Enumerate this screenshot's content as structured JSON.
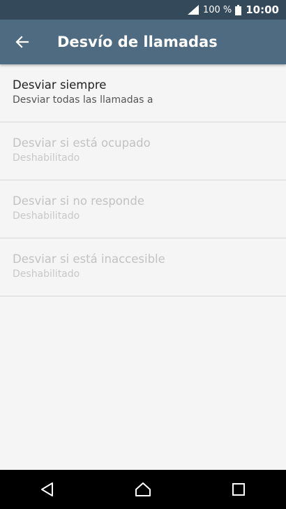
{
  "status_bar": {
    "battery_percent": "100 %",
    "time": "10:00",
    "icons": [
      "signal-icon",
      "battery-icon"
    ]
  },
  "app_bar": {
    "title": "Desvío de llamadas",
    "back_icon": "back-arrow-icon"
  },
  "settings": [
    {
      "title": "Desviar siempre",
      "summary": "Desviar todas las llamadas a",
      "enabled": true
    },
    {
      "title": "Desviar si está ocupado",
      "summary": "Deshabilitado",
      "enabled": false
    },
    {
      "title": "Desviar si no responde",
      "summary": "Deshabilitado",
      "enabled": false
    },
    {
      "title": "Desviar si está inaccesible",
      "summary": "Deshabilitado",
      "enabled": false
    }
  ],
  "nav_bar": {
    "icons": [
      "back-icon",
      "home-icon",
      "recents-icon"
    ]
  },
  "colors": {
    "status_bar": "#34495a",
    "app_bar": "#4f6b81",
    "background": "#f5f5f5",
    "nav_bar": "#000000"
  }
}
